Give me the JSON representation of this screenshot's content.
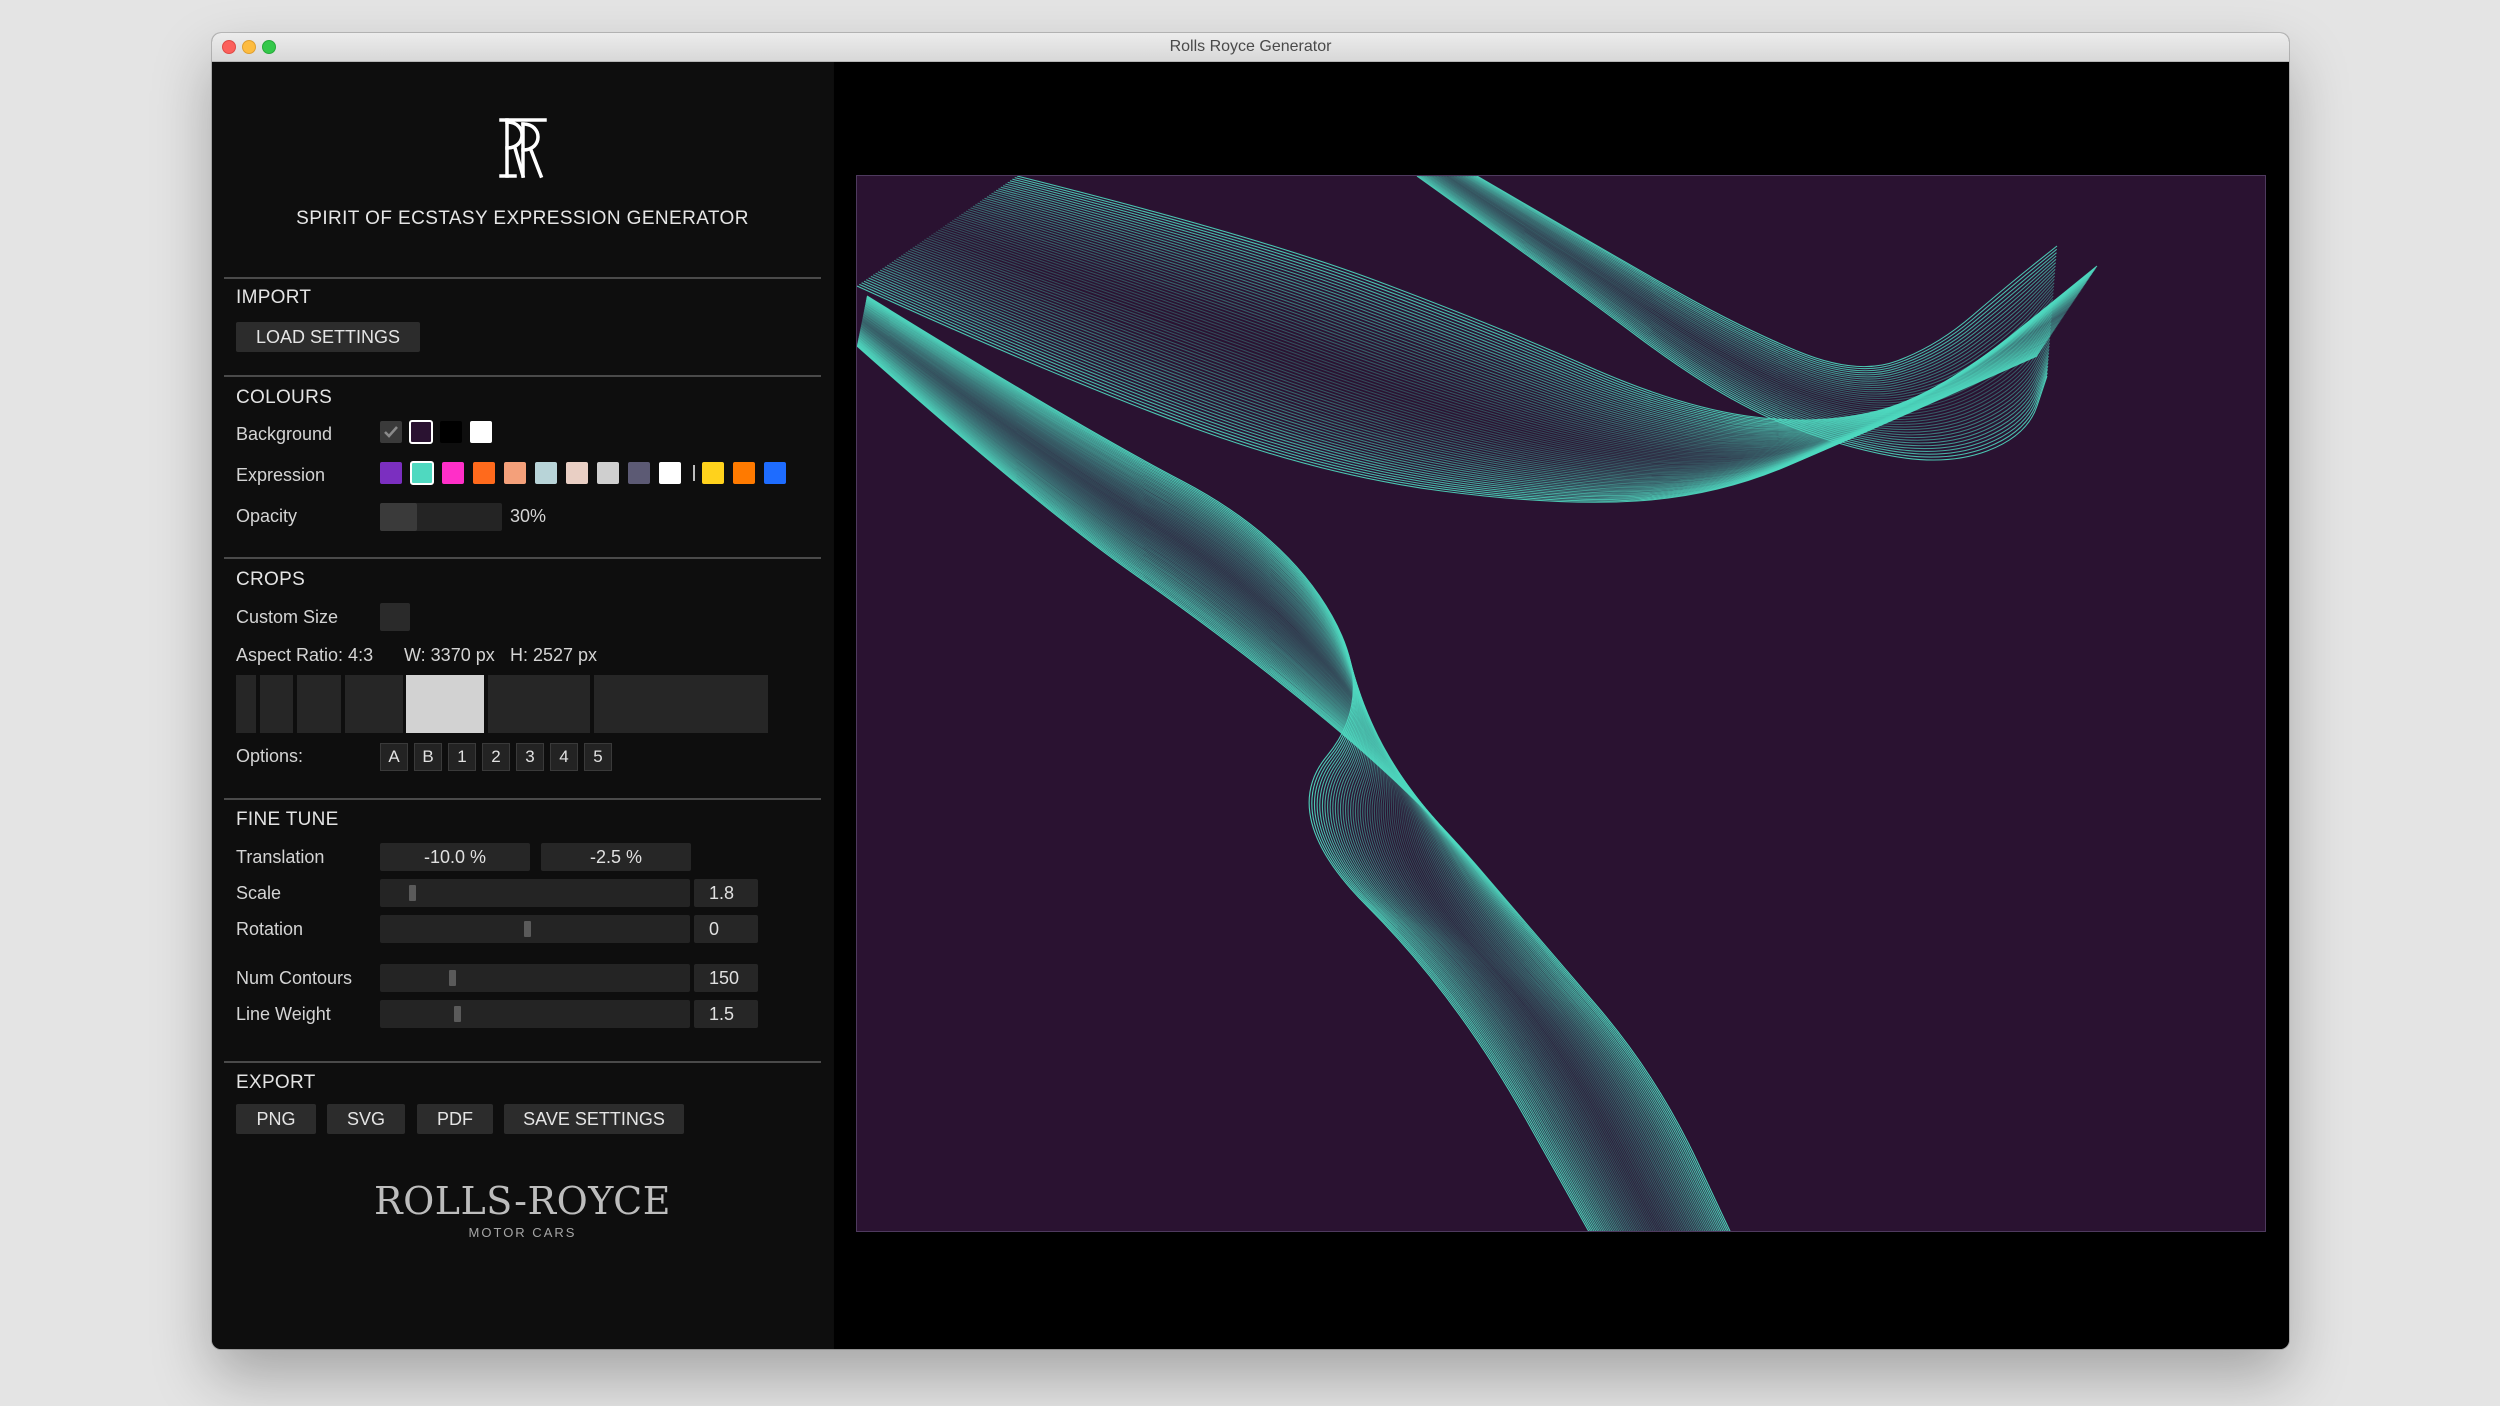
{
  "window": {
    "title": "Rolls Royce Generator"
  },
  "sidebar": {
    "heading": "SPIRIT OF ECSTASY EXPRESSION GENERATOR",
    "import": {
      "title": "IMPORT",
      "load_label": "LOAD SETTINGS"
    },
    "colours": {
      "title": "COLOURS",
      "background_label": "Background",
      "background_swatches": [
        "#3a3a3a",
        "#2a1231",
        "#000000",
        "#ffffff"
      ],
      "background_selected": 1,
      "expression_label": "Expression",
      "expression_swatches": [
        "#7b2fc0",
        "#4fd9c0",
        "#ff2fc8",
        "#ff6a1c",
        "#f4a07a",
        "#b8d4d8",
        "#e9cfc4",
        "#cfcfcf",
        "#5c5a74",
        "#ffffff",
        "#ffd21c",
        "#ff7a00",
        "#1e6cff"
      ],
      "expression_selected": 1,
      "opacity_label": "Opacity",
      "opacity_value": "30%",
      "opacity_level": 0.3
    },
    "crops": {
      "title": "CROPS",
      "custom_size_label": "Custom Size",
      "aspect": "Aspect Ratio: 4:3",
      "width": "W: 3370 px",
      "height": "H: 2527 px",
      "options_label": "Options:",
      "options": [
        "A",
        "B",
        "1",
        "2",
        "3",
        "4",
        "5"
      ]
    },
    "fine_tune": {
      "title": "FINE TUNE",
      "translation_label": "Translation",
      "translation_x": "-10.0 %",
      "translation_y": "-2.5 %",
      "scale_label": "Scale",
      "scale_value": "1.8",
      "rotation_label": "Rotation",
      "rotation_value": "0",
      "contours_label": "Num Contours",
      "contours_value": "150",
      "weight_label": "Line Weight",
      "weight_value": "1.5"
    },
    "export": {
      "title": "EXPORT",
      "png": "PNG",
      "svg": "SVG",
      "pdf": "PDF",
      "save": "SAVE SETTINGS"
    },
    "brand": {
      "wordmark": "ROLLS-ROYCE",
      "sub": "MOTOR CARS",
      "monogram": "RR"
    }
  },
  "canvas": {
    "background": "#2a1231",
    "stroke": "#4fd9c0"
  }
}
